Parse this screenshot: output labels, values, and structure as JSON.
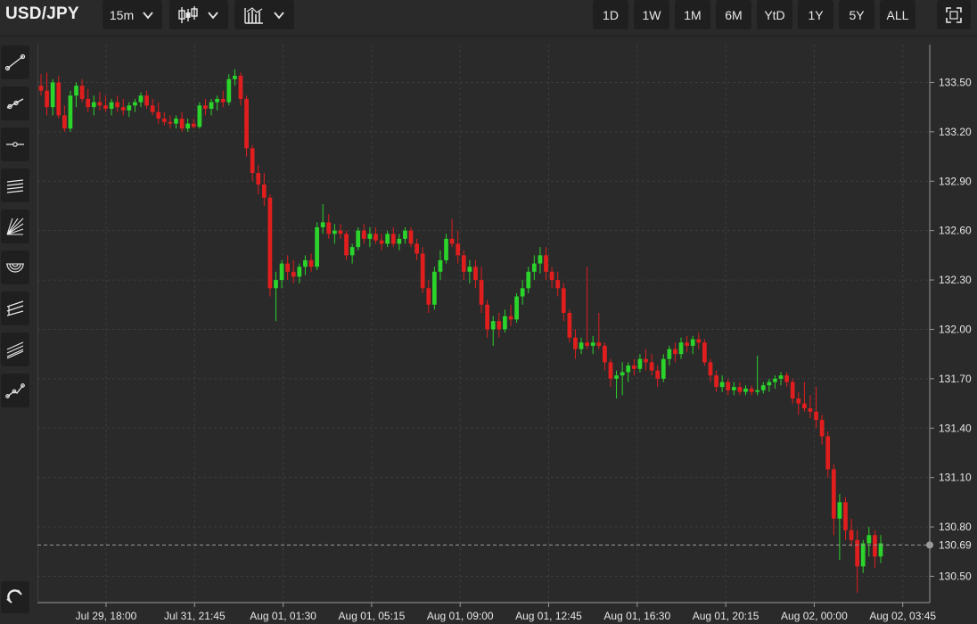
{
  "header": {
    "symbol": "USD/JPY",
    "interval": "15m",
    "chart_type_icon": "candlestick-icon",
    "indicators_icon": "bar-chart-icon",
    "ranges": [
      "1D",
      "1W",
      "1M",
      "6M",
      "YtD",
      "1Y",
      "5Y",
      "ALL"
    ],
    "fullscreen_icon": "fullscreen-icon"
  },
  "sidebar": {
    "tools": [
      "trend-line-icon",
      "ray-icon",
      "horizontal-line-icon",
      "parallel-channel-icon",
      "gann-fan-icon",
      "fibonacci-arc-icon",
      "pitchfork-icon",
      "fibonacci-channel-icon",
      "polyline-icon"
    ],
    "bottom_tool": "magnet-icon"
  },
  "colors": {
    "background": "#2a2a2a",
    "up": "#2bd32b",
    "down": "#e01e1e",
    "grid": "#3c3c3c",
    "axis": "#9a9a9a"
  },
  "chart_data": {
    "type": "candlestick",
    "title": "",
    "xlabel": "",
    "ylabel": "",
    "ylim": [
      130.34,
      133.73
    ],
    "y_ticks": [
      "133.50",
      "133.20",
      "132.90",
      "132.60",
      "132.30",
      "132.00",
      "131.70",
      "131.40",
      "131.10",
      "130.80",
      "130.50"
    ],
    "x_ticks": [
      "Jul 29, 18:00",
      "Jul 31, 21:45",
      "Aug 01, 01:30",
      "Aug 01, 05:15",
      "Aug 01, 09:00",
      "Aug 01, 12:45",
      "Aug 01, 16:30",
      "Aug 01, 20:15",
      "Aug 02, 00:00",
      "Aug 02, 03:45"
    ],
    "last_price": "130.69",
    "grid": true,
    "candles": [
      [
        133.48,
        133.55,
        133.42,
        133.45
      ],
      [
        133.45,
        133.56,
        133.3,
        133.35
      ],
      [
        133.35,
        133.52,
        133.3,
        133.5
      ],
      [
        133.5,
        133.54,
        133.28,
        133.3
      ],
      [
        133.3,
        133.36,
        133.2,
        133.22
      ],
      [
        133.22,
        133.45,
        133.2,
        133.42
      ],
      [
        133.42,
        133.5,
        133.35,
        133.48
      ],
      [
        133.48,
        133.52,
        133.38,
        133.4
      ],
      [
        133.4,
        133.46,
        133.32,
        133.35
      ],
      [
        133.35,
        133.42,
        133.3,
        133.38
      ],
      [
        133.38,
        133.44,
        133.33,
        133.36
      ],
      [
        133.36,
        133.42,
        133.32,
        133.34
      ],
      [
        133.34,
        133.4,
        133.3,
        133.38
      ],
      [
        133.38,
        133.42,
        133.32,
        133.35
      ],
      [
        133.35,
        133.4,
        133.3,
        133.33
      ],
      [
        133.33,
        133.38,
        133.29,
        133.36
      ],
      [
        133.36,
        133.4,
        133.32,
        133.38
      ],
      [
        133.38,
        133.44,
        133.35,
        133.42
      ],
      [
        133.42,
        133.45,
        133.34,
        133.36
      ],
      [
        133.36,
        133.4,
        133.3,
        133.32
      ],
      [
        133.32,
        133.38,
        133.25,
        133.28
      ],
      [
        133.28,
        133.32,
        133.24,
        133.26
      ],
      [
        133.26,
        133.3,
        133.22,
        133.25
      ],
      [
        133.25,
        133.3,
        133.22,
        133.28
      ],
      [
        133.28,
        133.32,
        133.2,
        133.22
      ],
      [
        133.22,
        133.28,
        133.2,
        133.25
      ],
      [
        133.25,
        133.28,
        133.22,
        133.23
      ],
      [
        133.23,
        133.38,
        133.22,
        133.36
      ],
      [
        133.36,
        133.4,
        133.3,
        133.34
      ],
      [
        133.34,
        133.4,
        133.3,
        133.38
      ],
      [
        133.38,
        133.42,
        133.33,
        133.4
      ],
      [
        133.4,
        133.45,
        133.35,
        133.38
      ],
      [
        133.38,
        133.55,
        133.36,
        133.52
      ],
      [
        133.52,
        133.58,
        133.48,
        133.54
      ],
      [
        133.54,
        133.56,
        133.36,
        133.4
      ],
      [
        133.4,
        133.42,
        133.05,
        133.1
      ],
      [
        133.1,
        133.12,
        132.9,
        132.95
      ],
      [
        132.95,
        133.0,
        132.82,
        132.88
      ],
      [
        132.88,
        132.95,
        132.75,
        132.8
      ],
      [
        132.8,
        132.82,
        132.2,
        132.25
      ],
      [
        132.25,
        132.35,
        132.05,
        132.3
      ],
      [
        132.3,
        132.42,
        132.25,
        132.4
      ],
      [
        132.4,
        132.45,
        132.3,
        132.35
      ],
      [
        132.35,
        132.42,
        132.28,
        132.32
      ],
      [
        132.32,
        132.4,
        132.28,
        132.38
      ],
      [
        132.38,
        132.45,
        132.33,
        132.42
      ],
      [
        132.42,
        132.46,
        132.35,
        132.38
      ],
      [
        132.38,
        132.65,
        132.36,
        132.62
      ],
      [
        132.62,
        132.76,
        132.58,
        132.65
      ],
      [
        132.65,
        132.7,
        132.55,
        132.58
      ],
      [
        132.58,
        132.64,
        132.52,
        132.6
      ],
      [
        132.6,
        132.64,
        132.55,
        132.58
      ],
      [
        132.58,
        132.6,
        132.42,
        132.45
      ],
      [
        132.45,
        132.52,
        132.4,
        132.5
      ],
      [
        132.5,
        132.62,
        132.48,
        132.6
      ],
      [
        132.6,
        132.64,
        132.52,
        132.55
      ],
      [
        132.55,
        132.62,
        132.5,
        132.58
      ],
      [
        132.58,
        132.62,
        132.52,
        132.54
      ],
      [
        132.54,
        132.58,
        132.48,
        132.52
      ],
      [
        132.52,
        132.6,
        132.5,
        132.58
      ],
      [
        132.58,
        132.62,
        132.5,
        132.52
      ],
      [
        132.52,
        132.58,
        132.48,
        132.55
      ],
      [
        132.55,
        132.62,
        132.52,
        132.6
      ],
      [
        132.6,
        132.62,
        132.5,
        132.52
      ],
      [
        132.52,
        132.55,
        132.42,
        132.46
      ],
      [
        132.46,
        132.5,
        132.22,
        132.25
      ],
      [
        132.25,
        132.3,
        132.1,
        132.15
      ],
      [
        132.15,
        132.38,
        132.12,
        132.35
      ],
      [
        132.35,
        132.48,
        132.3,
        132.42
      ],
      [
        132.42,
        132.58,
        132.4,
        132.55
      ],
      [
        132.55,
        132.67,
        132.5,
        132.52
      ],
      [
        132.52,
        132.6,
        132.4,
        132.45
      ],
      [
        132.45,
        132.48,
        132.3,
        132.35
      ],
      [
        132.35,
        132.42,
        132.28,
        132.38
      ],
      [
        132.38,
        132.42,
        132.25,
        132.3
      ],
      [
        132.3,
        132.38,
        132.1,
        132.15
      ],
      [
        132.15,
        132.18,
        131.95,
        132.0
      ],
      [
        132.0,
        132.08,
        131.9,
        132.05
      ],
      [
        132.05,
        132.1,
        131.95,
        132.0
      ],
      [
        132.0,
        132.12,
        131.98,
        132.08
      ],
      [
        132.08,
        132.15,
        132.02,
        132.06
      ],
      [
        132.06,
        132.22,
        132.04,
        132.2
      ],
      [
        132.2,
        132.3,
        132.15,
        132.25
      ],
      [
        132.25,
        132.38,
        132.22,
        132.35
      ],
      [
        132.35,
        132.45,
        132.3,
        132.4
      ],
      [
        132.4,
        132.5,
        132.34,
        132.45
      ],
      [
        132.45,
        132.5,
        132.3,
        132.35
      ],
      [
        132.35,
        132.38,
        132.25,
        132.3
      ],
      [
        132.3,
        132.35,
        132.2,
        132.25
      ],
      [
        132.25,
        132.28,
        132.05,
        132.1
      ],
      [
        132.1,
        132.12,
        131.92,
        131.95
      ],
      [
        131.95,
        132.0,
        131.82,
        131.88
      ],
      [
        131.88,
        131.95,
        131.85,
        131.92
      ],
      [
        131.92,
        132.38,
        131.88,
        131.9
      ],
      [
        131.9,
        131.96,
        131.85,
        131.92
      ],
      [
        131.92,
        132.1,
        131.88,
        131.9
      ],
      [
        131.9,
        131.92,
        131.75,
        131.8
      ],
      [
        131.8,
        131.82,
        131.65,
        131.7
      ],
      [
        131.7,
        131.75,
        131.58,
        131.72
      ],
      [
        131.72,
        131.8,
        131.6,
        131.74
      ],
      [
        131.74,
        131.8,
        131.68,
        131.78
      ],
      [
        131.78,
        131.82,
        131.72,
        131.76
      ],
      [
        131.76,
        131.85,
        131.74,
        131.82
      ],
      [
        131.82,
        131.88,
        131.75,
        131.8
      ],
      [
        131.8,
        131.85,
        131.72,
        131.75
      ],
      [
        131.75,
        131.78,
        131.65,
        131.7
      ],
      [
        131.7,
        131.85,
        131.68,
        131.82
      ],
      [
        131.82,
        131.9,
        131.78,
        131.88
      ],
      [
        131.88,
        131.92,
        131.8,
        131.85
      ],
      [
        131.85,
        131.95,
        131.82,
        131.92
      ],
      [
        131.92,
        131.96,
        131.86,
        131.9
      ],
      [
        131.9,
        131.96,
        131.85,
        131.94
      ],
      [
        131.94,
        131.98,
        131.88,
        131.92
      ],
      [
        131.92,
        131.94,
        131.78,
        131.8
      ],
      [
        131.8,
        131.82,
        131.68,
        131.72
      ],
      [
        131.72,
        131.75,
        131.62,
        131.65
      ],
      [
        131.65,
        131.72,
        131.62,
        131.68
      ],
      [
        131.68,
        131.7,
        131.6,
        131.63
      ],
      [
        131.63,
        131.68,
        131.6,
        131.65
      ],
      [
        131.65,
        131.68,
        131.6,
        131.62
      ],
      [
        131.62,
        131.66,
        131.6,
        131.64
      ],
      [
        131.64,
        131.66,
        131.6,
        131.62
      ],
      [
        131.62,
        131.84,
        131.6,
        131.63
      ],
      [
        131.63,
        131.68,
        131.61,
        131.66
      ],
      [
        131.66,
        131.7,
        131.62,
        131.68
      ],
      [
        131.68,
        131.72,
        131.64,
        131.7
      ],
      [
        131.7,
        131.74,
        131.66,
        131.72
      ],
      [
        131.72,
        131.74,
        131.65,
        131.68
      ],
      [
        131.68,
        131.7,
        131.55,
        131.58
      ],
      [
        131.58,
        131.62,
        131.48,
        131.55
      ],
      [
        131.55,
        131.68,
        131.5,
        131.52
      ],
      [
        131.52,
        131.6,
        131.46,
        131.5
      ],
      [
        131.5,
        131.65,
        131.4,
        131.45
      ],
      [
        131.45,
        131.48,
        131.3,
        131.35
      ],
      [
        131.35,
        131.38,
        131.1,
        131.15
      ],
      [
        131.15,
        131.18,
        130.75,
        130.85
      ],
      [
        130.85,
        131.0,
        130.6,
        130.95
      ],
      [
        130.95,
        130.98,
        130.72,
        130.78
      ],
      [
        130.78,
        130.85,
        130.68,
        130.72
      ],
      [
        130.72,
        130.78,
        130.4,
        130.56
      ],
      [
        130.56,
        130.72,
        130.52,
        130.7
      ],
      [
        130.7,
        130.8,
        130.62,
        130.75
      ],
      [
        130.75,
        130.78,
        130.55,
        130.62
      ],
      [
        130.62,
        130.75,
        130.58,
        130.7
      ]
    ]
  }
}
